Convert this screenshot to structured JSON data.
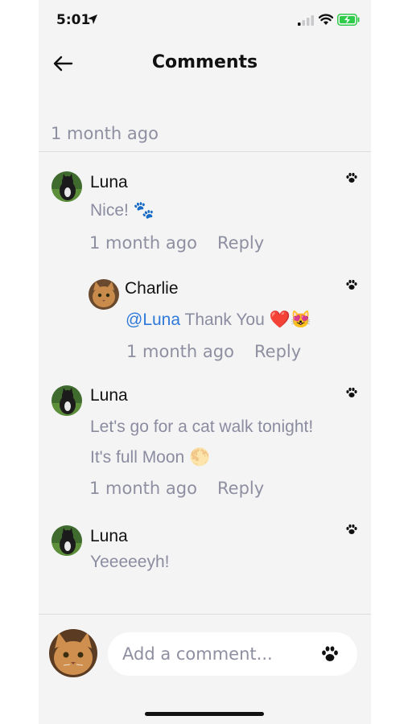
{
  "status_bar": {
    "time": "5:01"
  },
  "header": {
    "title": "Comments"
  },
  "post": {
    "time": "1 month ago"
  },
  "comments": [
    {
      "author": "Luna",
      "text": "Nice! 🐾",
      "time": "1 month ago",
      "reply_label": "Reply"
    },
    {
      "author": "Charlie",
      "mention": "@Luna",
      "text": "Thank You ❤️😻",
      "time": "1 month ago",
      "reply_label": "Reply"
    },
    {
      "author": "Luna",
      "text_line1": "Let's go for a cat walk tonight!",
      "text_line2": "It's full Moon 🌕",
      "time": "1 month ago",
      "reply_label": "Reply"
    },
    {
      "author": "Luna",
      "text": "Yeeeeeyh!"
    }
  ],
  "composer": {
    "placeholder": "Add a comment..."
  },
  "colors": {
    "background": "#f4f4f5",
    "muted_text": "#8e8fa0",
    "mention": "#2f7ad9",
    "battery_green": "#2fcb4a"
  },
  "icons": [
    "back-arrow-icon",
    "location-icon",
    "signal-icon",
    "wifi-icon",
    "battery-icon",
    "paw-icon"
  ]
}
